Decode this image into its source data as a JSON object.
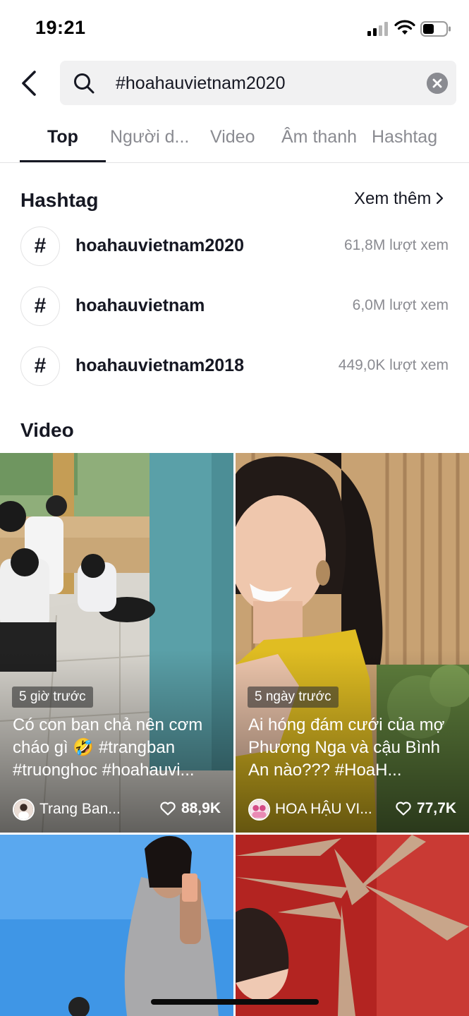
{
  "status_bar": {
    "time": "19:21"
  },
  "search": {
    "query": "#hoahauvietnam2020"
  },
  "tabs": [
    {
      "label": "Top",
      "active": true
    },
    {
      "label": "Người d..."
    },
    {
      "label": "Video"
    },
    {
      "label": "Âm thanh"
    },
    {
      "label": "Hashtag"
    }
  ],
  "hashtag_section": {
    "title": "Hashtag",
    "see_more": "Xem thêm",
    "items": [
      {
        "symbol": "#",
        "name": "hoahauvietnam2020",
        "views": "61,8M lượt xem"
      },
      {
        "symbol": "#",
        "name": "hoahauvietnam",
        "views": "6,0M lượt xem"
      },
      {
        "symbol": "#",
        "name": "hoahauvietnam2018",
        "views": "449,0K lượt xem"
      }
    ]
  },
  "video_section": {
    "title": "Video",
    "videos": [
      {
        "time": "5 giờ trước",
        "caption": "Có con bạn chả nên cơm cháo gì 🤣 #trangban #truonghoc #hoahauvi...",
        "author": "Trang Ban...",
        "likes": "88,9K"
      },
      {
        "time": "5 ngày trước",
        "caption": "Ai hóng đám cưới của mợ Phương Nga và cậu Bình An nào??? #HoaH...",
        "author": "HOA HẬU VI...",
        "likes": "77,7K"
      }
    ]
  },
  "colors": {
    "text_primary": "#161823",
    "text_secondary": "#8a8b91",
    "search_bg": "#f1f1f2"
  }
}
